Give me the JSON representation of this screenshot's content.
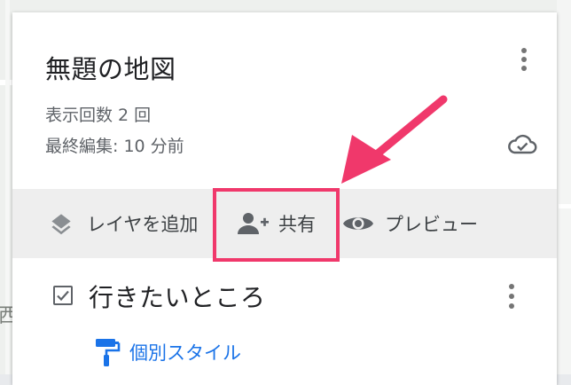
{
  "map": {
    "partial_label": "西"
  },
  "header": {
    "title": "無題の地図",
    "views": "表示回数 2 回",
    "last_edited": "最終編集: 10 分前"
  },
  "toolbar": {
    "add_layer": "レイヤを追加",
    "share": "共有",
    "preview": "プレビュー"
  },
  "layer": {
    "name": "行きたいところ",
    "checked": true,
    "style_label": "個別スタイル"
  },
  "colors": {
    "annotation": "#f0386b",
    "link": "#1a73e8",
    "toolbar_bg": "#eeeeee"
  },
  "icons": [
    "layers-icon",
    "person-add-icon",
    "eye-icon",
    "cloud-check-icon",
    "paint-roller-icon",
    "kebab-menu-icon",
    "checkbox-icon"
  ]
}
